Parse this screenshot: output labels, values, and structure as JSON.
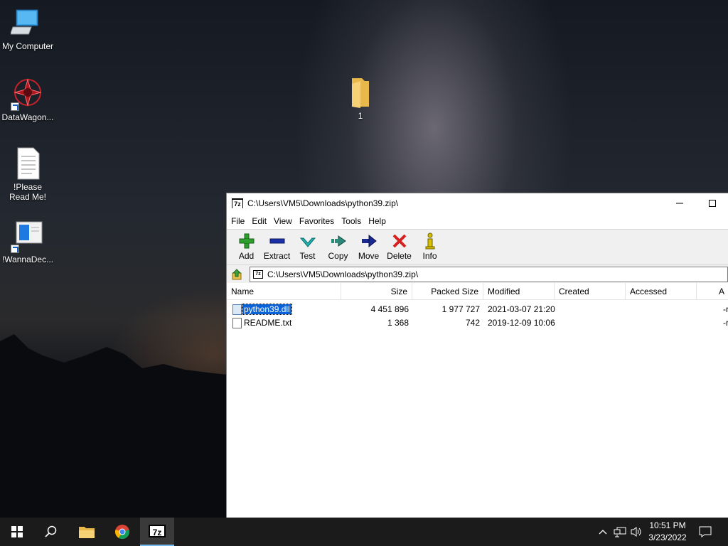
{
  "desktop": {
    "icons": [
      {
        "label": "My Computer"
      },
      {
        "label": "DataWagon..."
      },
      {
        "label": "!Please Read Me!"
      },
      {
        "label": "!WannaDec..."
      },
      {
        "label": "1"
      }
    ]
  },
  "window": {
    "title": "C:\\Users\\VM5\\Downloads\\python39.zip\\",
    "menu": [
      "File",
      "Edit",
      "View",
      "Favorites",
      "Tools",
      "Help"
    ],
    "toolbar": [
      {
        "label": "Add",
        "icon": "plus-icon",
        "color": "#2e9e2e"
      },
      {
        "label": "Extract",
        "icon": "minus-icon",
        "color": "#1a2fa8"
      },
      {
        "label": "Test",
        "icon": "check-icon",
        "color": "#1fb3b3"
      },
      {
        "label": "Copy",
        "icon": "copy-arrow-icon",
        "color": "#2a8a7a"
      },
      {
        "label": "Move",
        "icon": "move-arrow-icon",
        "color": "#1a2a90"
      },
      {
        "label": "Delete",
        "icon": "delete-x-icon",
        "color": "#d62020"
      },
      {
        "label": "Info",
        "icon": "info-icon",
        "color": "#d8c000"
      }
    ],
    "address": "C:\\Users\\VM5\\Downloads\\python39.zip\\",
    "columns": [
      "Name",
      "Size",
      "Packed Size",
      "Modified",
      "Created",
      "Accessed",
      "A"
    ],
    "files": [
      {
        "name": "python39.dll",
        "size": "4 451 896",
        "packed": "1 977 727",
        "modified": "2021-03-07 21:20",
        "attr": "-r",
        "selected": true
      },
      {
        "name": "README.txt",
        "size": "1 368",
        "packed": "742",
        "modified": "2019-12-09 10:06",
        "attr": "-r",
        "selected": false
      }
    ]
  },
  "taskbar": {
    "time": "10:51 PM",
    "date": "3/23/2022",
    "active_app_label": "7z"
  },
  "zip_logo_text": "7z"
}
